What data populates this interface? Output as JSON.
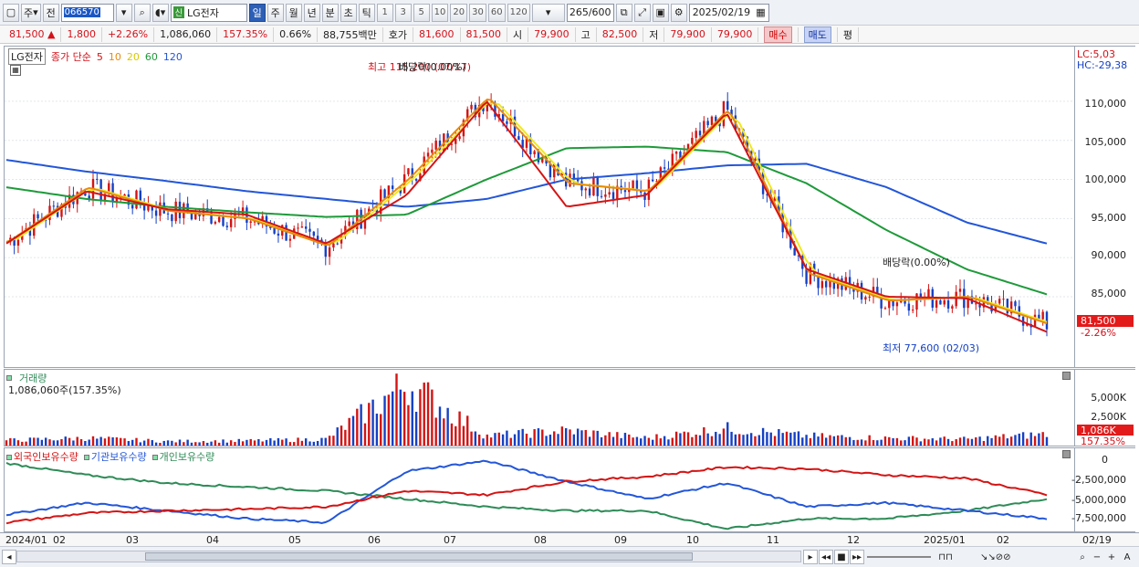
{
  "toolbar": {
    "cycle_label": "주",
    "prev_label": "전",
    "code": "066570",
    "stock_name": "LG전자",
    "name_badge": "신",
    "period_tabs": [
      "일",
      "주",
      "월",
      "년",
      "분",
      "초",
      "틱"
    ],
    "selected_period": "일",
    "minute_units": [
      "1",
      "3",
      "5",
      "10",
      "20",
      "30",
      "60",
      "120"
    ],
    "count": "265/600",
    "date": "2025/02/19"
  },
  "info": {
    "price": "81,500",
    "arrow": "▲",
    "change": "1,800",
    "change_pct": "+2.26%",
    "volume": "1,086,060",
    "volume_ratio": "157.35%",
    "turnover": "0.66%",
    "amount": "88,755백만",
    "quote_label": "호가",
    "ask": "81,600",
    "bid": "81,500",
    "open_label": "시",
    "open": "79,900",
    "high_label": "고",
    "high": "82,500",
    "low_label": "저",
    "low": "79,900",
    "last": "79,900",
    "buy_label": "매수",
    "sell_label": "매도",
    "avg_label": "평"
  },
  "price_pane": {
    "stock_tag": "LG전자",
    "ma_label": "종가 단순",
    "ma_periods": [
      "5",
      "10",
      "20",
      "60",
      "120"
    ],
    "ma_colors": {
      "5": "#d41414",
      "10": "#e88a10",
      "20": "#f0e820",
      "60": "#1e9a3a",
      "120": "#2356d8"
    },
    "lc_label": "LC:5,03",
    "hc_label": "HC:-29,38",
    "ticks": [
      "110,000",
      "105,000",
      "100,000",
      "95,000",
      "90,000",
      "85,000"
    ],
    "current_price": "81,500",
    "current_pct": "-2.26%",
    "high_annotation": "최고 115,200 (07/17)",
    "low_annotation": "최저 77,600 (02/03)",
    "div_annotation_1": "배당락(0.00%)",
    "div_annotation_2": "배당락(0.00%)"
  },
  "volume_pane": {
    "title": "거래량",
    "value": "1,086,060주(157.35%)",
    "ticks": [
      "5,000K",
      "2,500K"
    ],
    "current": "1,086K",
    "current_pct": "157.35%"
  },
  "holding_pane": {
    "legend": [
      "외국인보유수량",
      "기관보유수량",
      "개인보유수량"
    ],
    "legend_colors": [
      "#d41414",
      "#2356d8",
      "#2e8b57"
    ],
    "ticks": [
      "0",
      "-2,500,000",
      "-5,000,000",
      "-7,500,000"
    ]
  },
  "xaxis": {
    "labels": [
      "2024/01",
      "02",
      "03",
      "04",
      "05",
      "06",
      "07",
      "08",
      "09",
      "10",
      "11",
      "12",
      "2025/01",
      "02",
      "02/19"
    ]
  },
  "chart_data": {
    "type": "candlestick",
    "x": [
      "2024/01",
      "02",
      "03",
      "04",
      "05",
      "06",
      "07",
      "08",
      "09",
      "10",
      "11",
      "12",
      "2025/01",
      "02"
    ],
    "close": [
      92000,
      99000,
      96000,
      95000,
      91500,
      100000,
      110500,
      99500,
      98500,
      109000,
      88000,
      84500,
      85000,
      81500
    ],
    "ma5": [
      91800,
      98500,
      96200,
      95500,
      91800,
      98000,
      110000,
      96500,
      98000,
      108500,
      88500,
      85000,
      84800,
      80500
    ],
    "ma60": [
      99000,
      97500,
      96500,
      95800,
      95200,
      95500,
      100000,
      104000,
      104200,
      103500,
      99500,
      93500,
      88500,
      85300
    ],
    "ma120": [
      102500,
      101000,
      99800,
      98500,
      97500,
      96500,
      97500,
      100000,
      100800,
      101800,
      102000,
      99000,
      94500,
      91800
    ],
    "volume_K": [
      500,
      700,
      400,
      450,
      600,
      5800,
      900,
      1400,
      700,
      1600,
      900,
      700,
      600,
      1086
    ],
    "foreign_holding": [
      -8000000,
      -6800000,
      -6500000,
      -6300000,
      -6000000,
      -4000000,
      -4500000,
      -2800000,
      -2200000,
      -1000000,
      -1200000,
      -2000000,
      -2400000,
      -4500000
    ],
    "institution_holding": [
      -7000000,
      -5500000,
      -6500000,
      -7500000,
      -8000000,
      -1500000,
      -200000,
      -2800000,
      -5000000,
      -3000000,
      -6000000,
      -5500000,
      -6500000,
      -7500000
    ],
    "individual_holding": [
      -500000,
      -2000000,
      -3000000,
      -3500000,
      -4000000,
      -5000000,
      -6000000,
      -6500000,
      -6500000,
      -8800000,
      -7500000,
      -7500000,
      -6500000,
      -5000000
    ],
    "ylim": [
      76000,
      117000
    ]
  }
}
